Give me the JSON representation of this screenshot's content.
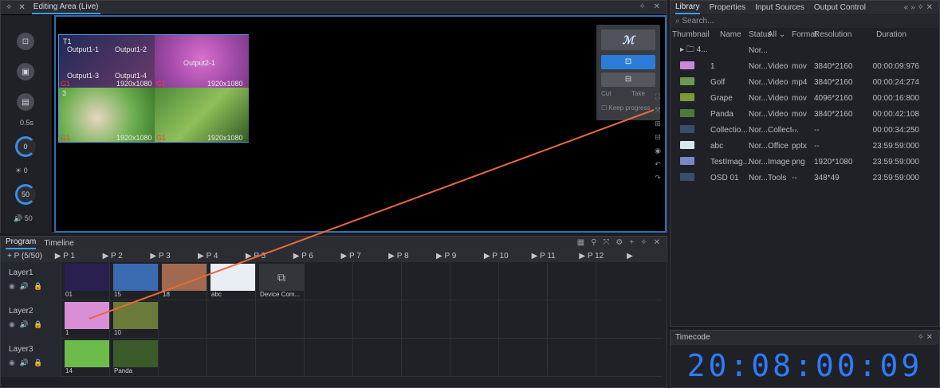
{
  "editing": {
    "title": "Editing Area (Live)",
    "outputs": [
      "Output1-1",
      "Output1-2",
      "Output1-3",
      "Output1-4",
      "Output2-1"
    ],
    "res": [
      "1920x1080",
      "1920x1080",
      "1920x1080",
      "1920x1080"
    ],
    "labels": {
      "t1": "T1",
      "g": "G1",
      "layer3": "3"
    },
    "left": {
      "speed": "0.5s",
      "volume_val": "0",
      "brightness": "50",
      "sound": "50"
    },
    "dock": {
      "cut": "Cut",
      "take": "Take",
      "keep": "Keep progress"
    }
  },
  "program": {
    "tabs": [
      "Program",
      "Timeline"
    ],
    "pages": [
      "+ P (5/50)",
      "▶ P 1",
      "▶ P 2",
      "▶ P 3",
      "▶ P 4",
      "▶ P 5",
      "▶ P 6",
      "▶ P 7",
      "▶ P 8",
      "▶ P 9",
      "▶ P 10",
      "▶ P 11",
      "▶ P 12",
      "▶"
    ],
    "layers": [
      {
        "name": "Layer1",
        "thumbs": [
          "01",
          "15",
          "18",
          "abc",
          "Device Com..."
        ]
      },
      {
        "name": "Layer2",
        "thumbs": [
          "1",
          "10"
        ]
      },
      {
        "name": "Layer3",
        "thumbs": [
          "14",
          "Panda"
        ]
      }
    ]
  },
  "library": {
    "tabs": [
      "Library",
      "Properties",
      "Input Sources",
      "Output Control"
    ],
    "search_placeholder": "Search...",
    "headers": [
      "Thumbnail",
      "Name",
      "Status",
      "All",
      "Format",
      "Resolution",
      "Duration"
    ],
    "rows": [
      {
        "thumb": "▸ 🗀 4...",
        "name": "",
        "status": "Nor...",
        "type": "",
        "fmt": "",
        "res": "",
        "dur": ""
      },
      {
        "thumb": "",
        "name": "1",
        "status": "Nor...",
        "type": "Video",
        "fmt": "mov",
        "res": "3840*2160",
        "dur": "00:00:09:976",
        "color": "#c78bd6"
      },
      {
        "thumb": "",
        "name": "Golf",
        "status": "Nor...",
        "type": "Video",
        "fmt": "mp4",
        "res": "3840*2160",
        "dur": "00:00:24:274",
        "color": "#6a9b55"
      },
      {
        "thumb": "",
        "name": "Grape",
        "status": "Nor...",
        "type": "Video",
        "fmt": "mov",
        "res": "4096*2160",
        "dur": "00:00:16:800",
        "color": "#7c9a3a"
      },
      {
        "thumb": "",
        "name": "Panda",
        "status": "Nor...",
        "type": "Video",
        "fmt": "mov",
        "res": "3840*2160",
        "dur": "00:00:42:108",
        "color": "#4c7a3a"
      },
      {
        "thumb": "",
        "name": "Collectio...",
        "status": "Nor...",
        "type": "Collect...",
        "fmt": "--",
        "res": "--",
        "dur": "00:00:34:250",
        "color": "#3a4d6a"
      },
      {
        "thumb": "",
        "name": "abc",
        "status": "Nor...",
        "type": "Office",
        "fmt": "pptx",
        "res": "--",
        "dur": "23:59:59:000",
        "color": "#d8e6f0"
      },
      {
        "thumb": "",
        "name": "TestImag...",
        "status": "Nor...",
        "type": "Image",
        "fmt": "png",
        "res": "1920*1080",
        "dur": "23:59:59:000",
        "color": "#7a86c8"
      },
      {
        "thumb": "",
        "name": "OSD 01",
        "status": "Nor...",
        "type": "Tools",
        "fmt": "--",
        "res": "348*49",
        "dur": "23:59:59:000",
        "color": "#3a4d6a"
      }
    ]
  },
  "timecode": {
    "title": "Timecode",
    "value": "20:08:00:09"
  }
}
